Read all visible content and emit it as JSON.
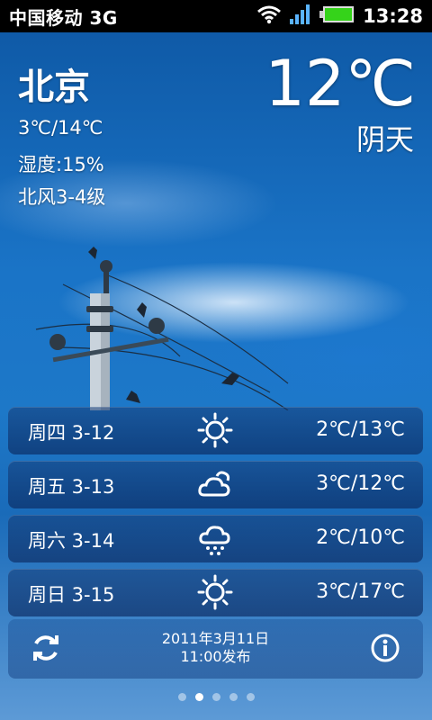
{
  "status_bar": {
    "carrier": "中国移动 3G",
    "time": "13:28"
  },
  "weather": {
    "city": "北京",
    "current_temp": "12℃",
    "condition": "阴天",
    "range": "3℃/14℃",
    "humidity": "湿度:15%",
    "wind": "北风3-4级"
  },
  "forecast": [
    {
      "day": "周四 3-12",
      "icon": "sunny-icon",
      "range": "2℃/13℃"
    },
    {
      "day": "周五 3-13",
      "icon": "cloudy-icon",
      "range": "3℃/12℃"
    },
    {
      "day": "周六 3-14",
      "icon": "rain-icon",
      "range": "2℃/10℃"
    },
    {
      "day": "周日 3-15",
      "icon": "sunny-icon",
      "range": "3℃/17℃"
    }
  ],
  "footer": {
    "publish_date": "2011年3月11日",
    "publish_time": "11:00发布"
  },
  "pager": {
    "pages": 5,
    "active": 2
  }
}
